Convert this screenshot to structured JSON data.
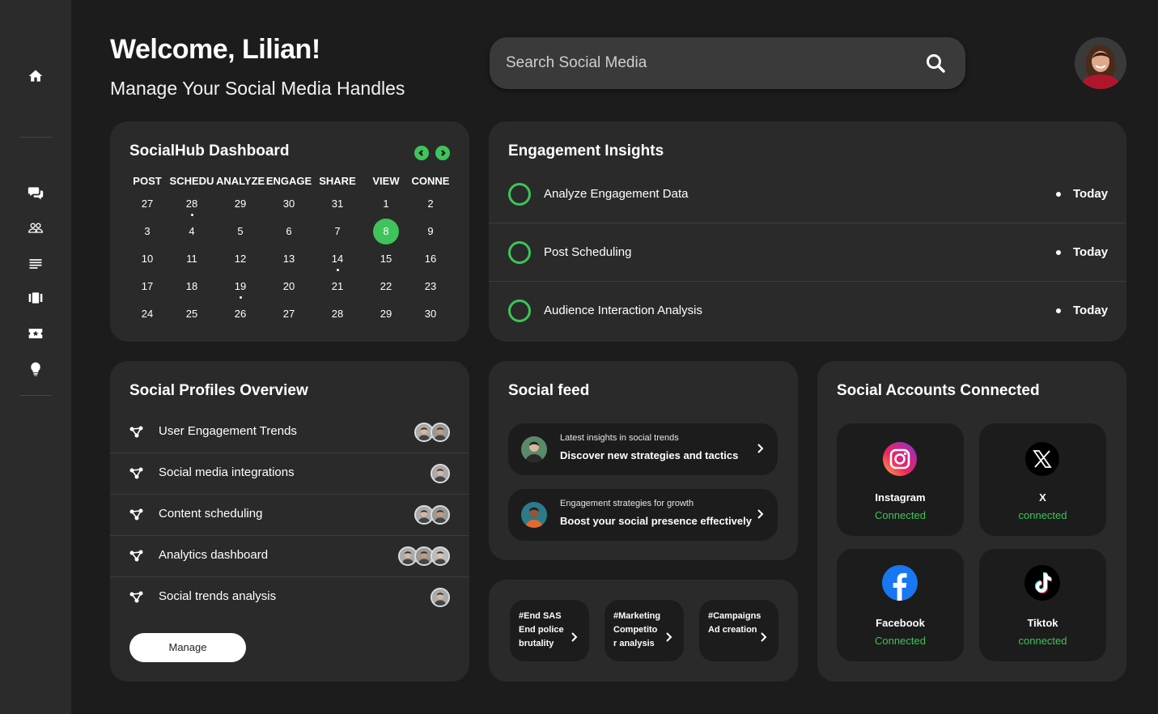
{
  "header": {
    "welcome": "Welcome, Lilian!",
    "subtitle": "Manage Your Social Media Handles",
    "search_placeholder": "Search Social Media"
  },
  "sidebar": {
    "icons": [
      "home-icon",
      "chat-icon",
      "people-icon",
      "list-icon",
      "carousel-icon",
      "ticket-icon",
      "lightbulb-icon"
    ]
  },
  "calendar": {
    "title": "SocialHub Dashboard",
    "headers": [
      "POST",
      "SCHEDU",
      "ANALYZE",
      "ENGAGE",
      "SHARE",
      "VIEW",
      "CONNE"
    ],
    "weeks": [
      [
        "27",
        "28",
        "29",
        "30",
        "31",
        "1",
        "2"
      ],
      [
        "3",
        "4",
        "5",
        "6",
        "7",
        "8",
        "9"
      ],
      [
        "10",
        "11",
        "12",
        "13",
        "14",
        "15",
        "16"
      ],
      [
        "17",
        "18",
        "19",
        "20",
        "21",
        "22",
        "23"
      ],
      [
        "24",
        "25",
        "26",
        "27",
        "28",
        "29",
        "30"
      ]
    ],
    "selected": "8",
    "accent": "#3fc35a"
  },
  "engagement": {
    "title": "Engagement Insights",
    "items": [
      {
        "label": "Analyze Engagement Data",
        "when": "Today"
      },
      {
        "label": "Post Scheduling",
        "when": "Today"
      },
      {
        "label": "Audience Interaction Analysis",
        "when": "Today"
      }
    ]
  },
  "profiles": {
    "title": "Social Profiles Overview",
    "items": [
      {
        "label": "User Engagement Trends",
        "avatars": 2
      },
      {
        "label": "Social media integrations",
        "avatars": 1
      },
      {
        "label": "Content scheduling",
        "avatars": 2
      },
      {
        "label": "Analytics dashboard",
        "avatars": 3
      },
      {
        "label": "Social trends analysis",
        "avatars": 1
      }
    ],
    "manage_label": "Manage"
  },
  "feed": {
    "title": "Social feed",
    "items": [
      {
        "small": "Latest insights in social trends",
        "big": "Discover new strategies and tactics"
      },
      {
        "small": "Engagement strategies for growth",
        "big": "Boost your social presence effectively"
      }
    ]
  },
  "tags": [
    {
      "lines": [
        "#End SAS",
        "End police",
        "brutality"
      ]
    },
    {
      "lines": [
        "#Marketing",
        "Competito",
        "r analysis"
      ]
    },
    {
      "lines": [
        "#Campaigns",
        "Ad creation"
      ]
    }
  ],
  "accounts": {
    "title": "Social Accounts Connected",
    "items": [
      {
        "name": "Instagram",
        "status": "Connected",
        "icon": "instagram-icon"
      },
      {
        "name": "X",
        "status": "connected",
        "icon": "x-icon"
      },
      {
        "name": "Facebook",
        "status": "Connected",
        "icon": "facebook-icon"
      },
      {
        "name": "Tiktok",
        "status": "connected",
        "icon": "tiktok-icon"
      }
    ]
  }
}
